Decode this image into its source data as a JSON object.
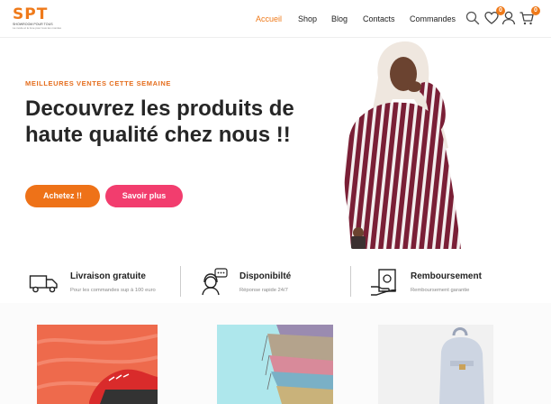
{
  "header": {
    "logo": {
      "letters": "SPT",
      "subtitle": "SHOWROOM POUR TOUS",
      "tagline": "La mode et le luxe pour tous les mondes"
    },
    "nav": [
      {
        "label": "Accueil",
        "active": true
      },
      {
        "label": "Shop",
        "active": false
      },
      {
        "label": "Blog",
        "active": false
      },
      {
        "label": "Contacts",
        "active": false
      },
      {
        "label": "Commandes",
        "active": false
      }
    ],
    "icons": {
      "search": "search-icon",
      "wishlist": "heart-icon",
      "account": "user-icon",
      "cart": "cart-icon"
    },
    "wishlist_count": "0",
    "cart_count": "0"
  },
  "hero": {
    "eyebrow": "MEILLEURES VENTES CETTE SEMAINE",
    "title": "Decouvrez les produits de haute qualité chez nous !!",
    "buy_label": "Achetez !!",
    "more_label": "Savoir plus"
  },
  "features": [
    {
      "icon": "delivery-truck-icon",
      "title": "Livraison gratuite",
      "subtitle": "Pour les commandes sup à 100 euro"
    },
    {
      "icon": "support-agent-icon",
      "title": "Disponibilté",
      "subtitle": "Réponse rapide 24/7"
    },
    {
      "icon": "refund-money-icon",
      "title": "Remboursement",
      "subtitle": "Remboursement garantie"
    }
  ],
  "colors": {
    "accent": "#ee7218",
    "pink": "#f23d6e",
    "text": "#262626"
  }
}
